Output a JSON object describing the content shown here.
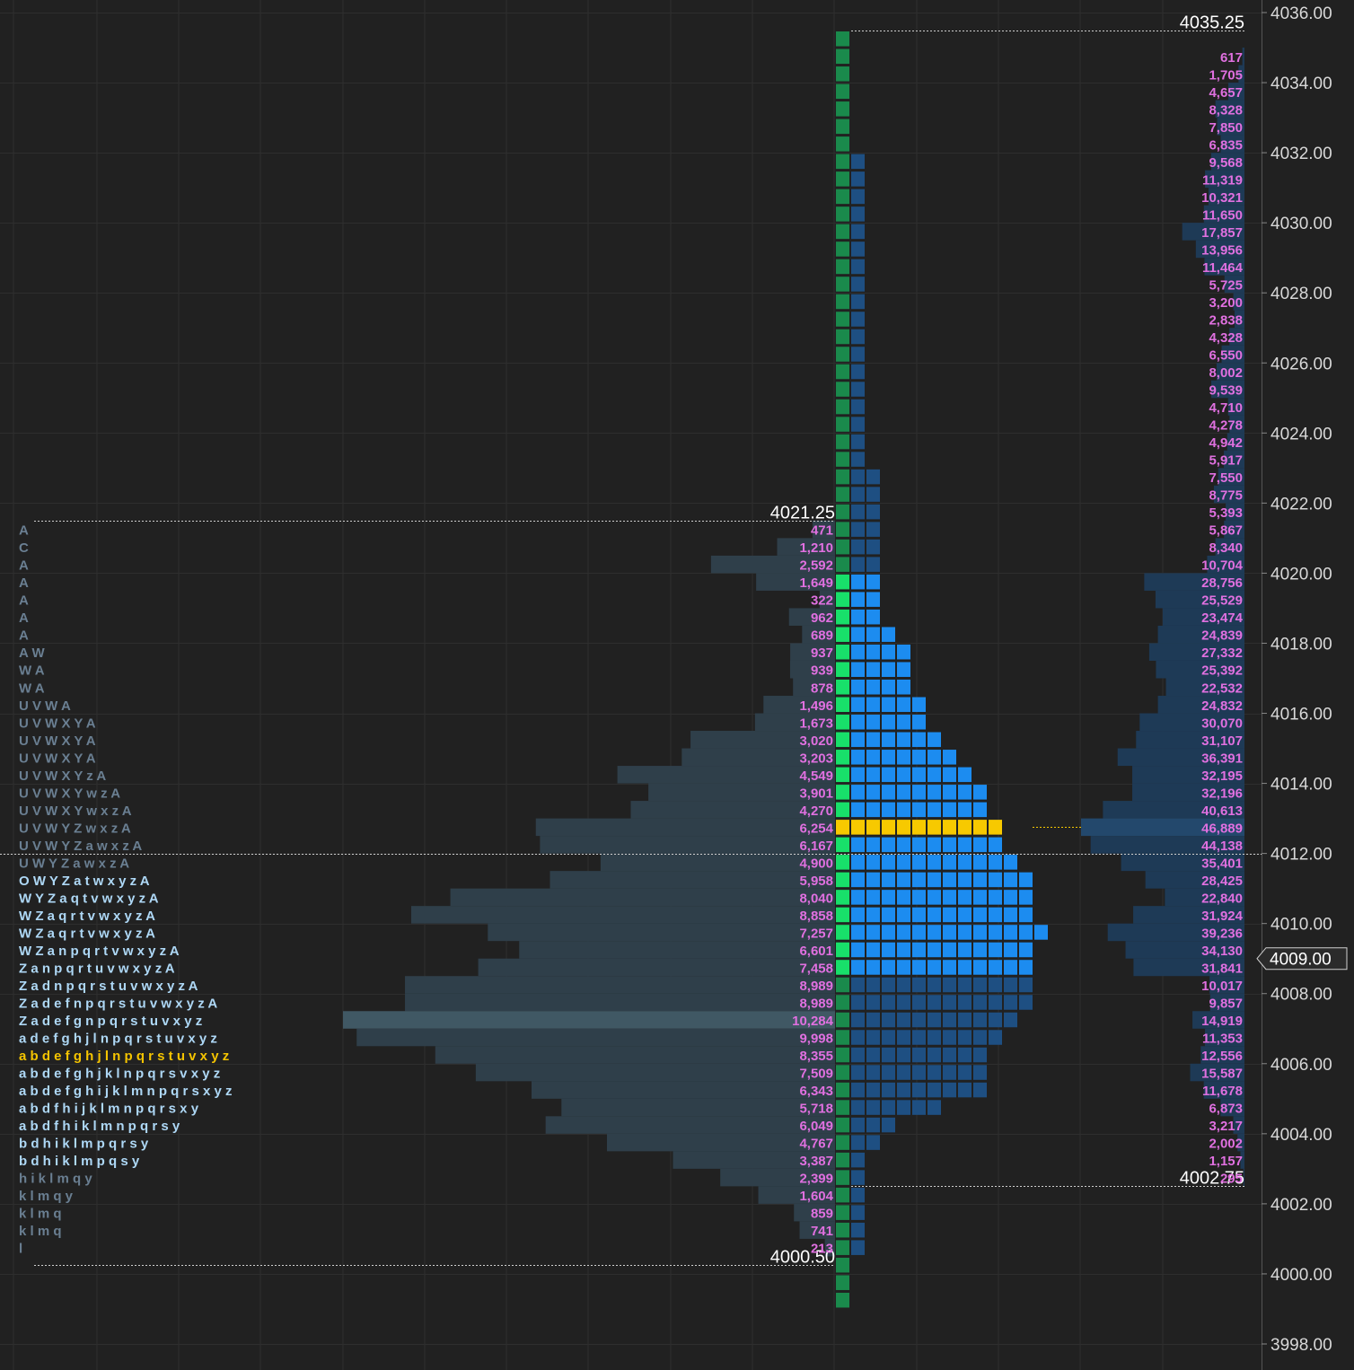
{
  "colors": {
    "background": "#212121",
    "grid": "#2e2e2e",
    "profile_left": "#2f3f4a",
    "profile_left_poc": "#405864",
    "profile_right": "#1e3a56",
    "profile_right_poc": "#23486c",
    "volume_label": "#e070e0",
    "tpo_green_dark": "#1a8a4c",
    "tpo_green_bright": "#18e06a",
    "tpo_blue_dark": "#1e4f82",
    "tpo_blue_bright": "#1c8cf0",
    "poc_yellow": "#f7c900",
    "letters_dim": "#6a7f92",
    "letters_bright": "#aed8f6",
    "letters_poc": "#f5c400",
    "price_marker_bg": "#2b2b2b"
  },
  "price_axis": {
    "ticks": [
      "4036.00",
      "4034.00",
      "4032.00",
      "4030.00",
      "4028.00",
      "4026.00",
      "4024.00",
      "4022.00",
      "4020.00",
      "4018.00",
      "4016.00",
      "4014.00",
      "4012.00",
      "4010.00",
      "4008.00",
      "4006.00",
      "4004.00",
      "4002.00",
      "4000.00",
      "3998.00"
    ],
    "current_price": "4009.00"
  },
  "chart_data": [
    {
      "type": "bar",
      "orientation": "horizontal",
      "name_hint": "left profile volume",
      "high_label": "4021.25",
      "low_label": "4000.50",
      "high": 4021.25,
      "low": 4000.5,
      "tick_size": 0.5,
      "poc": 4007.25,
      "values": [
        {
          "price": 4021.25,
          "volume": "471",
          "v": 471
        },
        {
          "price": 4020.75,
          "volume": "1,210",
          "v": 1210
        },
        {
          "price": 4020.25,
          "volume": "2,592",
          "v": 2592
        },
        {
          "price": 4019.75,
          "volume": "1,649",
          "v": 1649
        },
        {
          "price": 4019.25,
          "volume": "322",
          "v": 322
        },
        {
          "price": 4018.75,
          "volume": "962",
          "v": 962
        },
        {
          "price": 4018.25,
          "volume": "689",
          "v": 689
        },
        {
          "price": 4017.75,
          "volume": "937",
          "v": 937
        },
        {
          "price": 4017.25,
          "volume": "939",
          "v": 939
        },
        {
          "price": 4016.75,
          "volume": "878",
          "v": 878
        },
        {
          "price": 4016.25,
          "volume": "1,496",
          "v": 1496
        },
        {
          "price": 4015.75,
          "volume": "1,673",
          "v": 1673
        },
        {
          "price": 4015.25,
          "volume": "3,020",
          "v": 3020
        },
        {
          "price": 4014.75,
          "volume": "3,203",
          "v": 3203
        },
        {
          "price": 4014.25,
          "volume": "4,549",
          "v": 4549
        },
        {
          "price": 4013.75,
          "volume": "3,901",
          "v": 3901
        },
        {
          "price": 4013.25,
          "volume": "4,270",
          "v": 4270
        },
        {
          "price": 4012.75,
          "volume": "6,254",
          "v": 6254
        },
        {
          "price": 4012.25,
          "volume": "6,167",
          "v": 6167
        },
        {
          "price": 4011.75,
          "volume": "4,900",
          "v": 4900
        },
        {
          "price": 4011.25,
          "volume": "5,958",
          "v": 5958
        },
        {
          "price": 4010.75,
          "volume": "8,040",
          "v": 8040
        },
        {
          "price": 4010.25,
          "volume": "8,858",
          "v": 8858
        },
        {
          "price": 4009.75,
          "volume": "7,257",
          "v": 7257
        },
        {
          "price": 4009.25,
          "volume": "6,601",
          "v": 6601
        },
        {
          "price": 4008.75,
          "volume": "7,458",
          "v": 7458
        },
        {
          "price": 4008.25,
          "volume": "8,989",
          "v": 8989
        },
        {
          "price": 4007.75,
          "volume": "8,989",
          "v": 8989
        },
        {
          "price": 4007.25,
          "volume": "10,284",
          "v": 10284
        },
        {
          "price": 4006.75,
          "volume": "9,998",
          "v": 9998
        },
        {
          "price": 4006.25,
          "volume": "8,355",
          "v": 8355
        },
        {
          "price": 4005.75,
          "volume": "7,509",
          "v": 7509
        },
        {
          "price": 4005.25,
          "volume": "6,343",
          "v": 6343
        },
        {
          "price": 4004.75,
          "volume": "5,718",
          "v": 5718
        },
        {
          "price": 4004.25,
          "volume": "6,049",
          "v": 6049
        },
        {
          "price": 4003.75,
          "volume": "4,767",
          "v": 4767
        },
        {
          "price": 4003.25,
          "volume": "3,387",
          "v": 3387
        },
        {
          "price": 4002.75,
          "volume": "2,399",
          "v": 2399
        },
        {
          "price": 4002.25,
          "volume": "1,604",
          "v": 1604
        },
        {
          "price": 4001.75,
          "volume": "859",
          "v": 859
        },
        {
          "price": 4001.25,
          "volume": "741",
          "v": 741
        },
        {
          "price": 4000.75,
          "volume": "213",
          "v": 213
        }
      ],
      "tpo_letters": [
        "A",
        "C",
        "A",
        "A",
        "A",
        "A",
        "A",
        "A W",
        "W A",
        "W A",
        "U V W A",
        "U V W X Y A",
        "U V W X Y A",
        "U V W X Y A",
        "U V W X Y z A",
        "U V W X Y w z A",
        "U V W X Y w x z A",
        "U V W Y Z w x z A",
        "U V W Y Z a w x z A",
        "U W Y Z a w x z A",
        "O W Y Z a t w x y z A",
        "W Y Z a q t v w x y z A",
        "W Z a q r t v w x y z A",
        "W Z a q r t v w x y z A",
        "W Z a n p q r t v w x y z A",
        "Z a n p q r t u v w x y z A",
        "Z a d n p q r s t u v w x y z A",
        "Z a d e f n p q r s t u v w x y z A",
        "Z a d e f g n p q r s t u v x y z",
        "a d e f g h j l n p q r s t u v x y z",
        "a b d e f g h j l n p q r s t u v x y z",
        "a b d e f g h j k l n p q r s v x y z",
        "a b d e f g h i j k l m n p q r s x y z",
        "a b d f h i j k l m n p q r s x y",
        "a b d f h i k l m n p q r s y",
        "b d h i k l m p q r s y",
        "b d h i k l m p q s y",
        "h i k l m q y",
        "k l m q y",
        "k l m q",
        "k l m q",
        "l"
      ]
    },
    {
      "type": "bar",
      "orientation": "horizontal",
      "name_hint": "right profile volume",
      "high_label": "4035.25",
      "low_label": "4002.75",
      "high": 4035.25,
      "low": 4002.75,
      "tick_size": 0.5,
      "poc": 4012.75,
      "current": 4009.0,
      "values": [
        {
          "price": 4034.75,
          "volume": "617",
          "v": 617
        },
        {
          "price": 4034.25,
          "volume": "1,705",
          "v": 1705
        },
        {
          "price": 4033.75,
          "volume": "4,657",
          "v": 4657
        },
        {
          "price": 4033.25,
          "volume": "8,328",
          "v": 8328
        },
        {
          "price": 4032.75,
          "volume": "7,850",
          "v": 7850
        },
        {
          "price": 4032.25,
          "volume": "6,835",
          "v": 6835
        },
        {
          "price": 4031.75,
          "volume": "9,568",
          "v": 9568
        },
        {
          "price": 4031.25,
          "volume": "11,319",
          "v": 11319
        },
        {
          "price": 4030.75,
          "volume": "10,321",
          "v": 10321
        },
        {
          "price": 4030.25,
          "volume": "11,650",
          "v": 11650
        },
        {
          "price": 4029.75,
          "volume": "17,857",
          "v": 17857
        },
        {
          "price": 4029.25,
          "volume": "13,956",
          "v": 13956
        },
        {
          "price": 4028.75,
          "volume": "11,464",
          "v": 11464
        },
        {
          "price": 4028.25,
          "volume": "5,725",
          "v": 5725
        },
        {
          "price": 4027.75,
          "volume": "3,200",
          "v": 3200
        },
        {
          "price": 4027.25,
          "volume": "2,838",
          "v": 2838
        },
        {
          "price": 4026.75,
          "volume": "4,328",
          "v": 4328
        },
        {
          "price": 4026.25,
          "volume": "6,550",
          "v": 6550
        },
        {
          "price": 4025.75,
          "volume": "8,002",
          "v": 8002
        },
        {
          "price": 4025.25,
          "volume": "9,539",
          "v": 9539
        },
        {
          "price": 4024.75,
          "volume": "4,710",
          "v": 4710
        },
        {
          "price": 4024.25,
          "volume": "4,278",
          "v": 4278
        },
        {
          "price": 4023.75,
          "volume": "4,942",
          "v": 4942
        },
        {
          "price": 4023.25,
          "volume": "5,917",
          "v": 5917
        },
        {
          "price": 4022.75,
          "volume": "7,550",
          "v": 7550
        },
        {
          "price": 4022.25,
          "volume": "8,775",
          "v": 8775
        },
        {
          "price": 4021.75,
          "volume": "5,393",
          "v": 5393
        },
        {
          "price": 4021.25,
          "volume": "5,867",
          "v": 5867
        },
        {
          "price": 4020.75,
          "volume": "8,340",
          "v": 8340
        },
        {
          "price": 4020.25,
          "volume": "10,704",
          "v": 10704
        },
        {
          "price": 4019.75,
          "volume": "28,756",
          "v": 28756
        },
        {
          "price": 4019.25,
          "volume": "25,529",
          "v": 25529
        },
        {
          "price": 4018.75,
          "volume": "23,474",
          "v": 23474
        },
        {
          "price": 4018.25,
          "volume": "24,839",
          "v": 24839
        },
        {
          "price": 4017.75,
          "volume": "27,332",
          "v": 27332
        },
        {
          "price": 4017.25,
          "volume": "25,392",
          "v": 25392
        },
        {
          "price": 4016.75,
          "volume": "22,532",
          "v": 22532
        },
        {
          "price": 4016.25,
          "volume": "24,832",
          "v": 24832
        },
        {
          "price": 4015.75,
          "volume": "30,070",
          "v": 30070
        },
        {
          "price": 4015.25,
          "volume": "31,107",
          "v": 31107
        },
        {
          "price": 4014.75,
          "volume": "36,391",
          "v": 36391
        },
        {
          "price": 4014.25,
          "volume": "32,195",
          "v": 32195
        },
        {
          "price": 4013.75,
          "volume": "32,196",
          "v": 32196
        },
        {
          "price": 4013.25,
          "volume": "40,613",
          "v": 40613
        },
        {
          "price": 4012.75,
          "volume": "46,889",
          "v": 46889
        },
        {
          "price": 4012.25,
          "volume": "44,138",
          "v": 44138
        },
        {
          "price": 4011.75,
          "volume": "35,401",
          "v": 35401
        },
        {
          "price": 4011.25,
          "volume": "28,425",
          "v": 28425
        },
        {
          "price": 4010.75,
          "volume": "22,840",
          "v": 22840
        },
        {
          "price": 4010.25,
          "volume": "31,924",
          "v": 31924
        },
        {
          "price": 4009.75,
          "volume": "39,236",
          "v": 39236
        },
        {
          "price": 4009.25,
          "volume": "34,130",
          "v": 34130
        },
        {
          "price": 4008.75,
          "volume": "31,841",
          "v": 31841
        },
        {
          "price": 4008.25,
          "volume": "10,017",
          "v": 10017
        },
        {
          "price": 4007.75,
          "volume": "9,857",
          "v": 9857
        },
        {
          "price": 4007.25,
          "volume": "14,919",
          "v": 14919
        },
        {
          "price": 4006.75,
          "volume": "11,353",
          "v": 11353
        },
        {
          "price": 4006.25,
          "volume": "12,556",
          "v": 12556
        },
        {
          "price": 4005.75,
          "volume": "15,587",
          "v": 15587
        },
        {
          "price": 4005.25,
          "volume": "11,678",
          "v": 11678
        },
        {
          "price": 4004.75,
          "volume": "6,873",
          "v": 6873
        },
        {
          "price": 4004.25,
          "volume": "3,217",
          "v": 3217
        },
        {
          "price": 4003.75,
          "volume": "2,002",
          "v": 2002
        },
        {
          "price": 4003.25,
          "volume": "1,157",
          "v": 1157
        },
        {
          "price": 4002.75,
          "volume": "295",
          "v": 295
        }
      ],
      "tpo_counts": [
        1,
        1,
        1,
        1,
        1,
        1,
        1,
        2,
        2,
        2,
        2,
        2,
        2,
        2,
        2,
        2,
        2,
        2,
        2,
        2,
        2,
        2,
        2,
        2,
        2,
        3,
        3,
        3,
        3,
        3,
        3,
        3,
        3,
        3,
        4,
        5,
        5,
        5,
        6,
        6,
        7,
        8,
        9,
        10,
        10,
        11,
        11,
        12,
        13,
        13,
        13,
        14,
        13,
        13,
        13,
        13,
        12,
        11,
        10,
        10,
        10,
        7,
        4,
        3,
        2,
        2,
        2,
        2,
        2,
        2,
        1,
        1,
        1
      ]
    }
  ]
}
